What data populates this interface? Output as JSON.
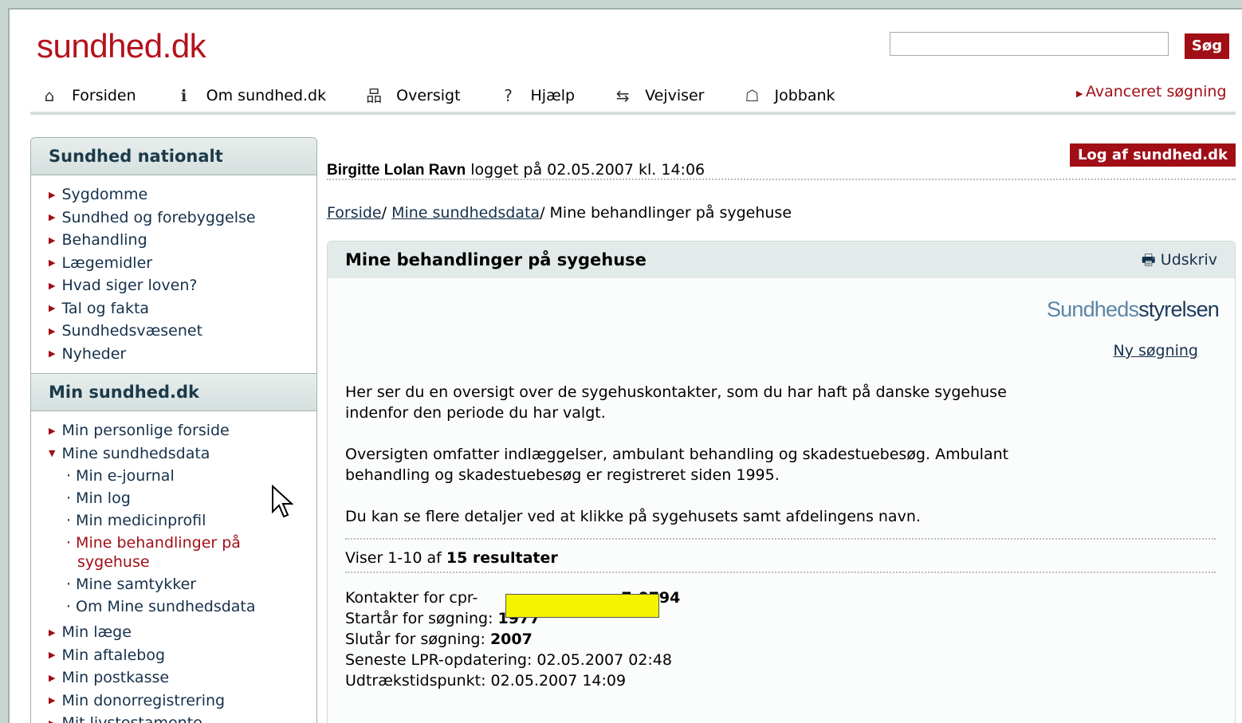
{
  "header": {
    "logo": "sundhed.dk",
    "search_value": "",
    "search_button": "Søg",
    "nav": [
      {
        "label": "Forsiden",
        "icon": "home-icon"
      },
      {
        "label": "Om sundhed.dk",
        "icon": "info-icon"
      },
      {
        "label": "Oversigt",
        "icon": "sitemap-icon"
      },
      {
        "label": "Hjælp",
        "icon": "help-icon"
      },
      {
        "label": "Vejviser",
        "icon": "signpost-icon"
      },
      {
        "label": "Jobbank",
        "icon": "jobbank-icon"
      }
    ],
    "advanced_search": "Avanceret søgning"
  },
  "sidebar": {
    "section1_title": "Sundhed nationalt",
    "section1_items": [
      "Sygdomme",
      "Sundhed og forebyggelse",
      "Behandling",
      "Lægemidler",
      "Hvad siger loven?",
      "Tal og fakta",
      "Sundhedsvæsenet",
      "Nyheder"
    ],
    "section2_title": "Min sundhed.dk",
    "item_personal": "Min personlige forside",
    "item_mine_data": "Mine sundhedsdata",
    "sub_items": [
      "Min e-journal",
      "Min log",
      "Min medicinprofil"
    ],
    "sub_active_line1": "Mine behandlinger på",
    "sub_active_line2": "sygehuse",
    "sub_items2": [
      "Mine samtykker",
      "Om Mine sundhedsdata"
    ],
    "more_items": [
      "Min læge",
      "Min aftalebog",
      "Min postkasse",
      "Min donorregistrering",
      "Mit livstestamente"
    ]
  },
  "main": {
    "user_name": "Birgitte Lolan Ravn",
    "login_text": " logget på 02.05.2007 kl. 14:06",
    "logout_button": "Log af sundhed.dk",
    "crumb1": "Forside",
    "crumb2": "Mine sundhedsdata",
    "crumb3": "Mine behandlinger på sygehuse",
    "box_title": "Mine behandlinger på sygehuse",
    "print_label": "Udskriv",
    "sst_logo_a": "Sundheds",
    "sst_logo_b": "styrelsen",
    "new_search": "Ny søgning",
    "para1_line1": "Her ser du en oversigt over de sygehuskontakter, som du har haft på danske sygehuse",
    "para1_line2": "indenfor den periode du har valgt.",
    "para2_line1": "Oversigten omfatter indlæggelser, ambulant behandling og skadestuebesøg. Ambulant",
    "para2_line2": "behandling og skadestuebesøg er registreret siden 1995.",
    "para3": "Du kan se flere detaljer ved at klikke på sygehusets samt afdelingens navn.",
    "results_prefix": "Viser 1-10 af ",
    "results_bold": "15 resultater",
    "contacts_label": "Kontakter for cpr-",
    "contacts_value": "7-0794",
    "start_label": "Startår for søgning: ",
    "start_value": "1977",
    "end_label": "Slutår for søgning: ",
    "end_value": "2007",
    "lpr_label": "Seneste LPR-opdatering:  02.05.2007 02:48",
    "extract_label": "Udtrækstidspunkt: 02.05.2007 14:09"
  }
}
